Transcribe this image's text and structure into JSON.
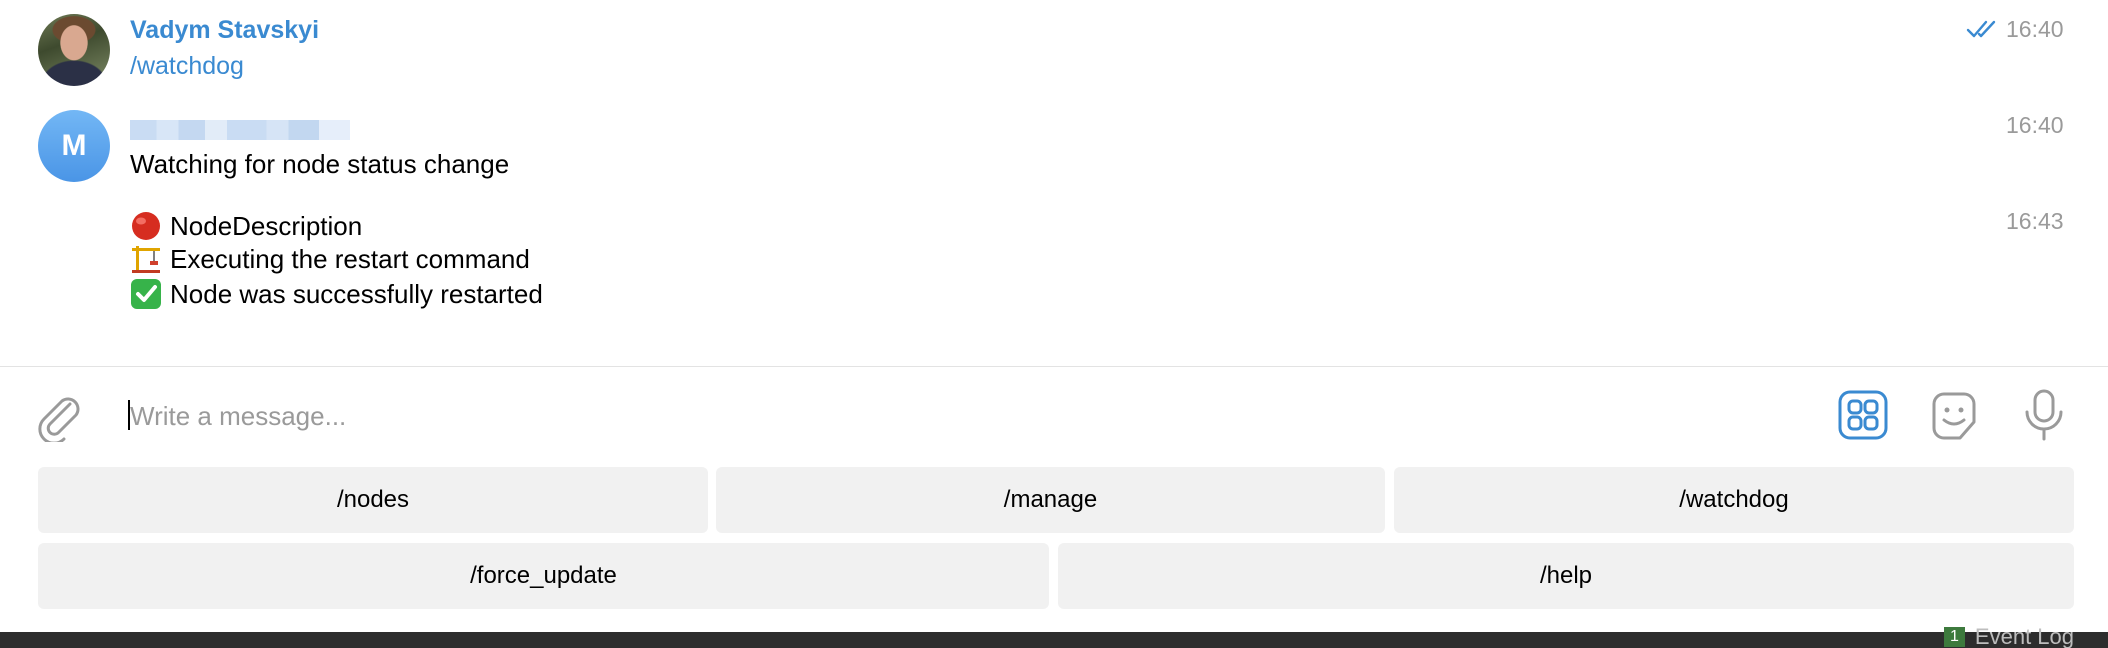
{
  "messages": [
    {
      "sender": "Vadym Stavskyi",
      "text": "/watchdog",
      "time": "16:40",
      "read": true
    },
    {
      "avatar_letter": "M",
      "text": "Watching for node status change",
      "time": "16:40"
    },
    {
      "lines": [
        {
          "icon": "red-circle-icon",
          "text": "NodeDescription"
        },
        {
          "icon": "crane-icon",
          "text": "Executing the restart command"
        },
        {
          "icon": "check-mark-icon",
          "text": "Node was successfully restarted"
        }
      ],
      "time": "16:43"
    }
  ],
  "composer": {
    "placeholder": "Write a message..."
  },
  "keyboard": {
    "row1": [
      "/nodes",
      "/manage",
      "/watchdog"
    ],
    "row2": [
      "/force_update",
      "/help"
    ]
  },
  "status_bar": {
    "badge": "1",
    "label": "Event Log"
  },
  "colors": {
    "link": "#3a8ad1",
    "timestamp": "#9a9a9a",
    "keyboard_button": "#f1f1f1",
    "accent": "#3a8ad1"
  }
}
